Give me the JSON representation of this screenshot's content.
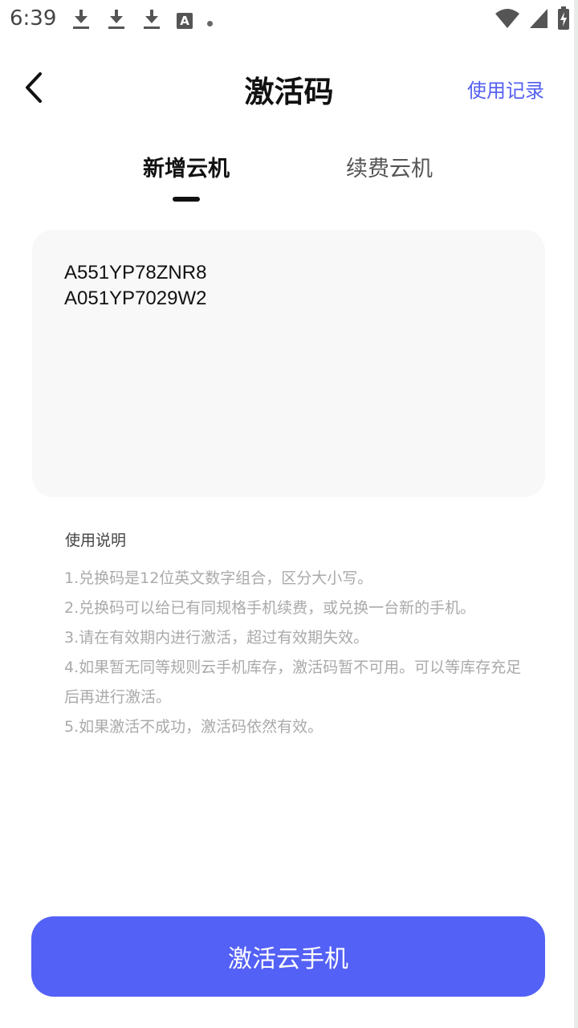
{
  "status_bar": {
    "time": "6:39",
    "icons_left": [
      "download-icon",
      "download-icon",
      "download-icon",
      "a-icon",
      "dot-icon"
    ],
    "icons_right": [
      "wifi-icon",
      "signal-icon",
      "battery-charging-icon"
    ]
  },
  "header": {
    "back_icon": "chevron-left-icon",
    "title": "激活码",
    "record_link": "使用记录"
  },
  "tabs": [
    {
      "label": "新增云机",
      "active": true
    },
    {
      "label": "续费云机",
      "active": false
    }
  ],
  "codes": [
    "A551YP78ZNR8",
    "A051YP7029W2"
  ],
  "instructions": {
    "title": "使用说明",
    "items": [
      "1.兑换码是12位英文数字组合，区分大小写。",
      "2.兑换码可以给已有同规格手机续费，或兑换一台新的手机。",
      "3.请在有效期内进行激活，超过有效期失效。",
      "4.如果暂无同等规则云手机库存，激活码暂不可用。可以等库存充足后再进行激活。",
      "5.如果激活不成功，激活码依然有效。"
    ]
  },
  "action": {
    "activate_label": "激活云手机"
  },
  "colors": {
    "accent": "#5461f6",
    "link": "#5460f0",
    "box_bg": "#f8f8f8"
  }
}
